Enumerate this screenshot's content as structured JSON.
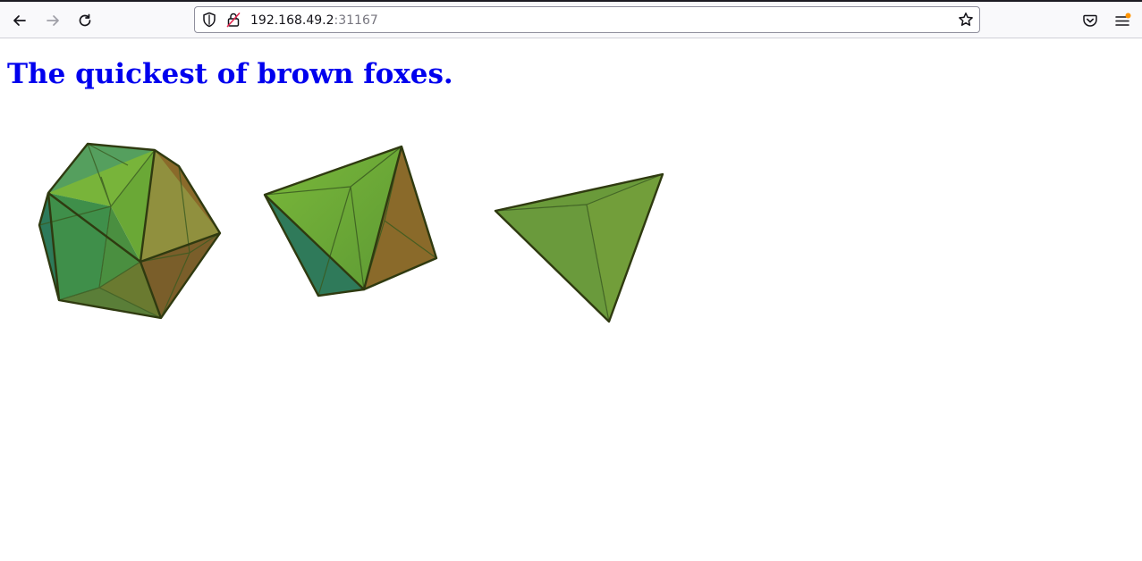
{
  "browser": {
    "url_host": "192.168.49.2",
    "url_port": ":31167",
    "icons": {
      "back": "arrow-left-icon",
      "forward": "arrow-right-icon",
      "reload": "reload-icon",
      "tracking": "shield-icon",
      "security": "insecure-lock-icon",
      "bookmark": "star-icon",
      "pocket": "pocket-icon",
      "menu": "hamburger-menu-icon"
    },
    "colors": {
      "notification_dot": "#ff9400"
    }
  },
  "page": {
    "title": "The quickest of brown foxes.",
    "title_color": "#0000ee",
    "solids": [
      "icosahedron",
      "octahedron",
      "tetrahedron"
    ],
    "solid_colors": {
      "green": "#6aa33a",
      "teal": "#2f7a5a",
      "brown": "#8a6a2a",
      "edge": "#2f3a10"
    }
  }
}
